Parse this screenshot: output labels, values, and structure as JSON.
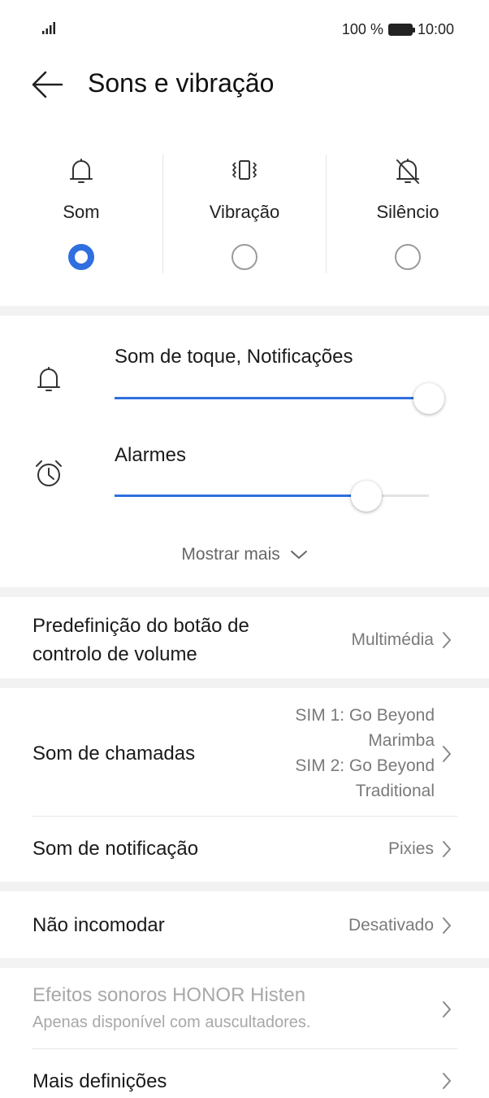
{
  "status_bar": {
    "battery": "100 %",
    "time": "10:00"
  },
  "header": {
    "title": "Sons e vibração"
  },
  "modes": [
    {
      "label": "Som",
      "selected": true
    },
    {
      "label": "Vibração",
      "selected": false
    },
    {
      "label": "Silêncio",
      "selected": false
    }
  ],
  "volume": {
    "ringtone_label": "Som de toque, Notificações",
    "ringtone_level": 1.0,
    "alarm_label": "Alarmes",
    "alarm_level": 0.8,
    "show_more": "Mostrar mais"
  },
  "settings": {
    "volume_button": {
      "label_line1": "Predefinição do botão de",
      "label_line2": "controlo de volume",
      "value": "Multimédia"
    },
    "call_sound": {
      "label": "Som de chamadas",
      "value_line1": "SIM 1: Go Beyond",
      "value_line2": "Marimba",
      "value_line3": "SIM 2: Go Beyond",
      "value_line4": "Traditional"
    },
    "notification_sound": {
      "label": "Som de notificação",
      "value": "Pixies"
    },
    "dnd": {
      "label": "Não incomodar",
      "value": "Desativado"
    },
    "histen": {
      "label": "Efeitos sonoros HONOR Histen",
      "subtitle": "Apenas disponível com auscultadores."
    },
    "more_settings": {
      "label": "Mais definições"
    }
  },
  "colors": {
    "accent": "#2f6fe0",
    "disabled": "#a8a8a8",
    "section_gap": "#f2f2f2"
  }
}
